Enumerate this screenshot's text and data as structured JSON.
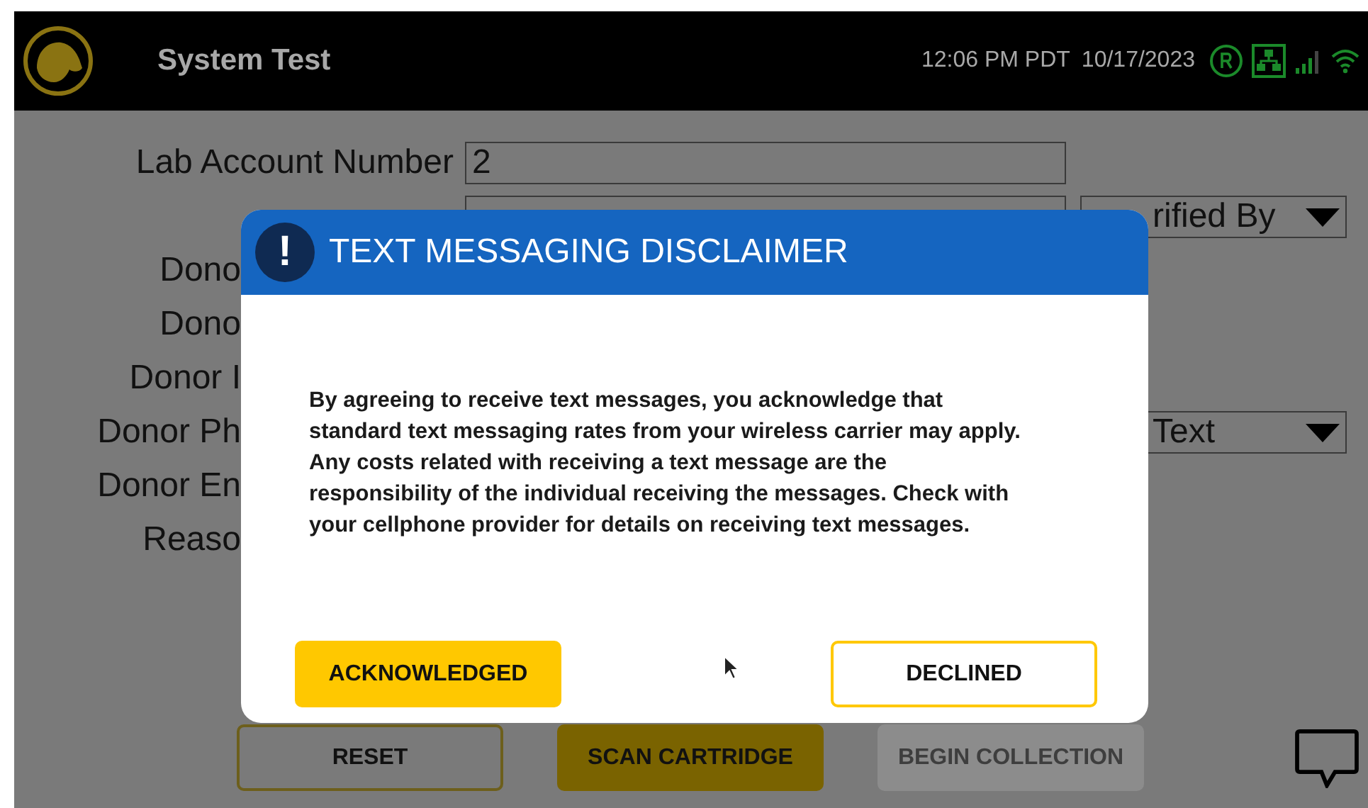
{
  "header": {
    "title": "System Test",
    "time": "12:06 PM PDT",
    "date": "10/17/2023"
  },
  "form": {
    "rows": [
      {
        "kind": "full",
        "label": "Lab Account Number",
        "value": "2"
      },
      {
        "kind": "full",
        "value": "",
        "dropdown": "rified By"
      },
      {
        "kind": "covered",
        "label": "Dono"
      },
      {
        "kind": "covered",
        "label": "Dono"
      },
      {
        "kind": "covered",
        "label": "Donor I"
      },
      {
        "kind": "covered",
        "label": "Donor Ph",
        "dropdown": "Text"
      },
      {
        "kind": "covered",
        "label": "Donor En"
      },
      {
        "kind": "covered",
        "label": "Reaso"
      }
    ]
  },
  "buttons": [
    {
      "kind": "outline",
      "label": "RESET",
      "disabled": false
    },
    {
      "kind": "filled",
      "label": "SCAN CARTRIDGE",
      "disabled": false
    },
    {
      "kind": "filled",
      "label": "BEGIN COLLECTION",
      "disabled": true
    }
  ],
  "dialog": {
    "title": "TEXT MESSAGING DISCLAIMER",
    "icon": "!",
    "message": "By agreeing to receive text messages, you acknowledge that\nstandard text messaging rates from your wireless carrier may apply.\nAny costs related with receiving a text message are the\nresponsibility of the individual receiving the messages. Check with\nyour cellphone provider for details on receiving text messages.",
    "buttons": [
      {
        "kind": "filled",
        "label": "ACKNOWLEDGED"
      },
      {
        "kind": "outline",
        "label": "DECLINED"
      }
    ]
  }
}
